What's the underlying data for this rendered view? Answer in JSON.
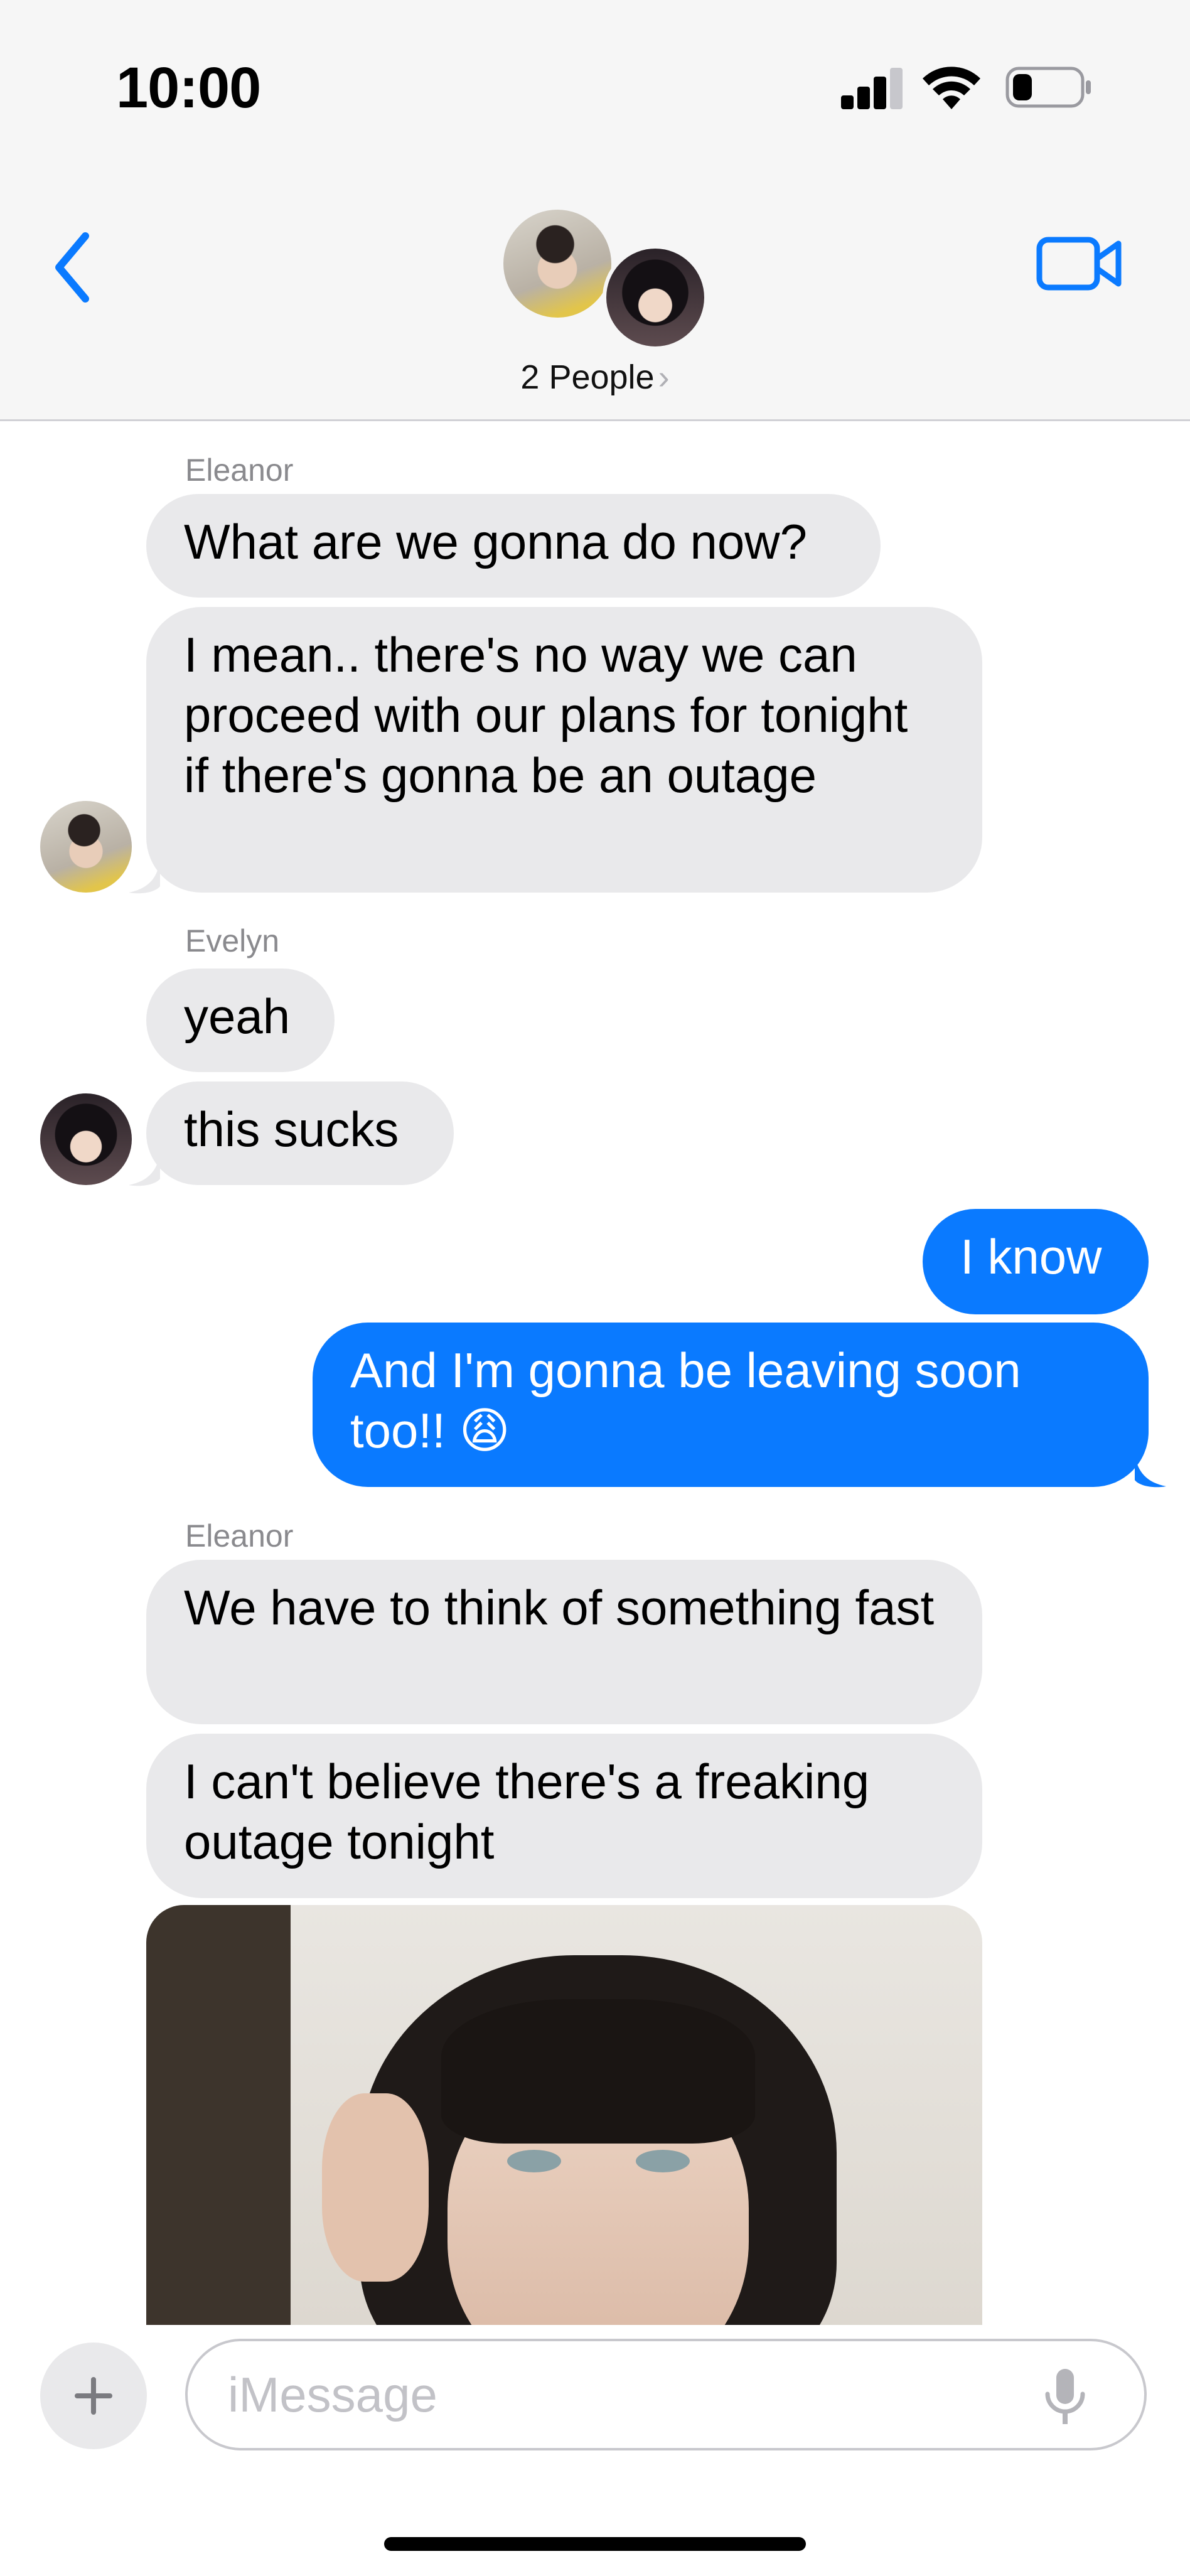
{
  "status_bar": {
    "time": "10:00"
  },
  "header": {
    "title": "2 People",
    "chevron": "›",
    "icons": [
      "back-chevron-icon",
      "video-camera-icon"
    ]
  },
  "messages": [
    {
      "sender": "Eleanor",
      "text": "What are we gonna do now?"
    },
    {
      "text": "I mean.. there's no way we can proceed with our plans for tonight if there's gonna be an outage"
    },
    {
      "sender": "Evelyn",
      "text": "yeah"
    },
    {
      "text": "this sucks"
    },
    {
      "text": "I know"
    },
    {
      "text": "And I'm gonna be leaving soon too!! 😩"
    },
    {
      "sender": "Eleanor",
      "text": "We have to think of something fast"
    },
    {
      "text": "I can't believe there's a freaking outage tonight"
    }
  ],
  "composer": {
    "placeholder": "iMessage"
  },
  "colors": {
    "incoming": "#e9e9eb",
    "outgoing": "#0a7aff",
    "accent": "#0a7aff"
  }
}
